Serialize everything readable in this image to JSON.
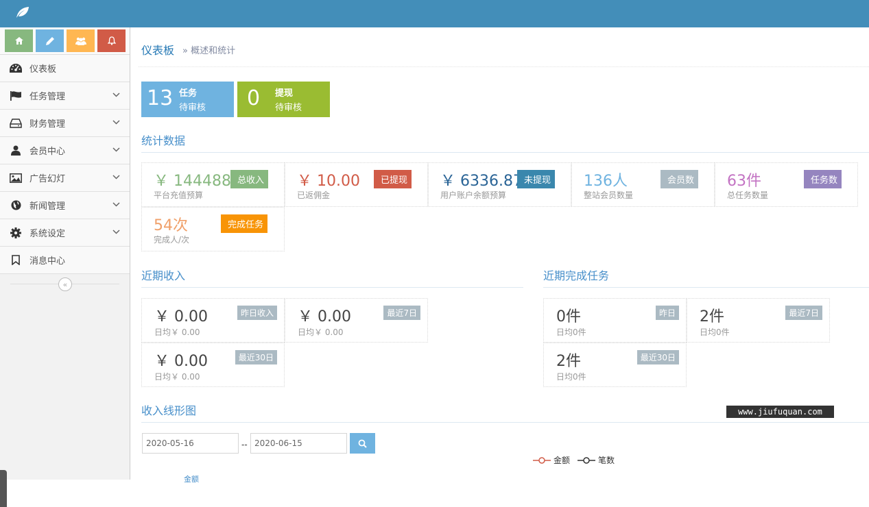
{
  "header": {
    "logo_icon": "leaf-icon",
    "color": "#438eb9"
  },
  "shortcuts": [
    {
      "icon": "home-icon",
      "color": "#87b87f"
    },
    {
      "icon": "pencil-icon",
      "color": "#6fb3e0"
    },
    {
      "icon": "users-icon",
      "color": "#ffb752"
    },
    {
      "icon": "bell-icon",
      "color": "#d15b47"
    }
  ],
  "sidebar": {
    "items": [
      {
        "label": "仪表板",
        "icon": "dashboard-icon"
      },
      {
        "label": "任务管理",
        "icon": "flag-icon"
      },
      {
        "label": "财务管理",
        "icon": "hdd-icon"
      },
      {
        "label": "会员中心",
        "icon": "user-icon"
      },
      {
        "label": "广告幻灯",
        "icon": "picture-icon"
      },
      {
        "label": "新闻管理",
        "icon": "globe-icon"
      },
      {
        "label": "系统设定",
        "icon": "cog-icon"
      },
      {
        "label": "消息中心",
        "icon": "bookmark-icon"
      }
    ]
  },
  "breadcrumb": {
    "title": "仪表板",
    "subtitle": "概述和统计"
  },
  "infoboxes": [
    {
      "number": "13",
      "line1": "任务",
      "line2": "待审核",
      "color": "#6fb3e0"
    },
    {
      "number": "0",
      "line1": "提现",
      "line2": "待审核",
      "color": "#9abc32"
    }
  ],
  "sections": {
    "stats": "统计数据",
    "recent_income": "近期收入",
    "recent_tasks": "近期完成任务",
    "income_chart": "收入线形图"
  },
  "stats": [
    {
      "value": "￥ 144488.",
      "desc": "平台充值预算",
      "ribbon": "总收入",
      "color": "#87b87f",
      "ribbon_color": "#87b87f"
    },
    {
      "value": "￥ 10.00",
      "desc": "已返佣金",
      "ribbon": "已提现",
      "color": "#d15b47",
      "ribbon_color": "#d15b47"
    },
    {
      "value": "￥ 6336.87",
      "desc": "用户账户余额预算",
      "ribbon": "未提现",
      "color": "#2a6496",
      "ribbon_color": "#3a87ad"
    },
    {
      "value": "136人",
      "desc": "整站会员数量",
      "ribbon": "会员数",
      "color": "#6fb3e0",
      "ribbon_color": "#abbac3"
    },
    {
      "value": "63件",
      "desc": "总任务数量",
      "ribbon": "任务数",
      "color": "#c373c3",
      "ribbon_color": "#9585bf"
    },
    {
      "value": "54次",
      "desc": "完成人/次",
      "ribbon": "完成任务",
      "color": "#f0a06a",
      "ribbon_color": "#f89406"
    }
  ],
  "income": [
    {
      "value": "￥ 0.00",
      "desc": "日均￥ 0.00",
      "tag": "昨日收入"
    },
    {
      "value": "￥ 0.00",
      "desc": "日均￥ 0.00",
      "tag": "最近7日"
    },
    {
      "value": "￥ 0.00",
      "desc": "日均￥ 0.00",
      "tag": "最近30日"
    }
  ],
  "tasks": [
    {
      "value": "0件",
      "desc": "日均0件",
      "tag": "昨日"
    },
    {
      "value": "2件",
      "desc": "日均0件",
      "tag": "最近7日"
    },
    {
      "value": "2件",
      "desc": "日均0件",
      "tag": "最近30日"
    }
  ],
  "date_range": {
    "start": "2020-05-16",
    "separator": "--",
    "end": "2020-06-15"
  },
  "chart": {
    "legend": [
      {
        "label": "金额",
        "color": "#d15b47"
      },
      {
        "label": "笔数",
        "color": "#333333"
      }
    ],
    "series_label": "金额"
  },
  "watermark": "www.jiufuquan.com"
}
